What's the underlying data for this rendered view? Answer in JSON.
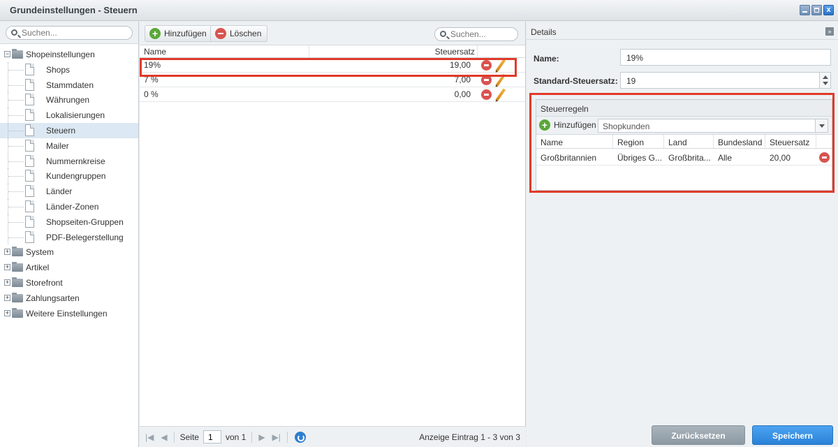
{
  "window": {
    "title": "Grundeinstellungen - Steuern",
    "close_glyph": "x"
  },
  "tree": {
    "search_placeholder": "Suchen...",
    "root": {
      "label": "Shopeinstellungen",
      "expander": "−"
    },
    "children": [
      "Shops",
      "Stammdaten",
      "Währungen",
      "Lokalisierungen",
      "Steuern",
      "Mailer",
      "Nummernkreise",
      "Kundengruppen",
      "Länder",
      "Länder-Zonen",
      "Shopseiten-Gruppen",
      "PDF-Belegerstellung"
    ],
    "selected": "Steuern",
    "folders": [
      {
        "label": "System",
        "expander": "+"
      },
      {
        "label": "Artikel",
        "expander": "+"
      },
      {
        "label": "Storefront",
        "expander": "+"
      },
      {
        "label": "Zahlungsarten",
        "expander": "+"
      },
      {
        "label": "Weitere Einstellungen",
        "expander": "+"
      }
    ]
  },
  "grid": {
    "add_label": "Hinzufügen",
    "delete_label": "Löschen",
    "search_placeholder": "Suchen...",
    "columns": [
      "Name",
      "Steuersatz"
    ],
    "rows": [
      {
        "name": "19%",
        "rate": "19,00"
      },
      {
        "name": "7 %",
        "rate": "7,00"
      },
      {
        "name": "0 %",
        "rate": "0,00"
      }
    ],
    "pager": {
      "first": "|◀",
      "prev": "◀",
      "next": "▶",
      "last": "▶|",
      "page_label": "Seite",
      "page_value": "1",
      "of_label": "von 1",
      "info": "Anzeige Eintrag 1 - 3 von 3"
    }
  },
  "details": {
    "title": "Details",
    "collapse_glyph": "»",
    "name_label": "Name:",
    "name_value": "19%",
    "default_rate_label": "Standard-Steuersatz:",
    "default_rate_value": "19",
    "rules": {
      "title": "Steuerregeln",
      "add_label": "Hinzufügen",
      "customer_group": "Shopkunden",
      "columns": [
        "Name",
        "Region",
        "Land",
        "Bundesland",
        "Steuersatz"
      ],
      "rows": [
        {
          "name": "Großbritannien",
          "region": "Übriges G...",
          "country": "Großbrita...",
          "state": "Alle",
          "rate": "20,00"
        }
      ]
    },
    "reset_label": "Zurücksetzen",
    "save_label": "Speichern"
  },
  "colors": {
    "highlight": "#e03a2a",
    "primary": "#2a82d8",
    "add": "#5aa83a",
    "delete": "#d9534f"
  }
}
